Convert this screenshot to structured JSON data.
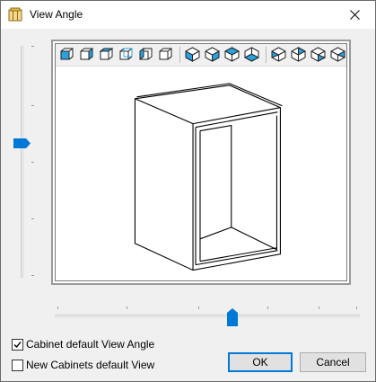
{
  "window": {
    "title": "View Angle"
  },
  "toolbar": {
    "buttons": [
      "view-front-icon",
      "view-front-left-icon",
      "view-front-right-icon",
      "view-back-icon",
      "view-left-icon",
      "view-right-icon",
      "iso-view-1-icon",
      "iso-view-2-icon",
      "iso-view-3-icon",
      "iso-view-4-icon",
      "iso-view-5-icon",
      "iso-view-6-icon",
      "iso-view-7-icon",
      "iso-view-8-icon"
    ]
  },
  "sliders": {
    "vertical": {
      "value": 0.43
    },
    "horizontal": {
      "value": 0.58
    }
  },
  "options": {
    "cabinet_default": {
      "label": "Cabinet default View Angle",
      "checked": true
    },
    "new_cabinets_default": {
      "label": "New Cabinets default View",
      "checked": false
    }
  },
  "buttons": {
    "ok": "OK",
    "cancel": "Cancel"
  },
  "colors": {
    "accent": "#0078d7",
    "icon_blue": "#29a3e0"
  }
}
